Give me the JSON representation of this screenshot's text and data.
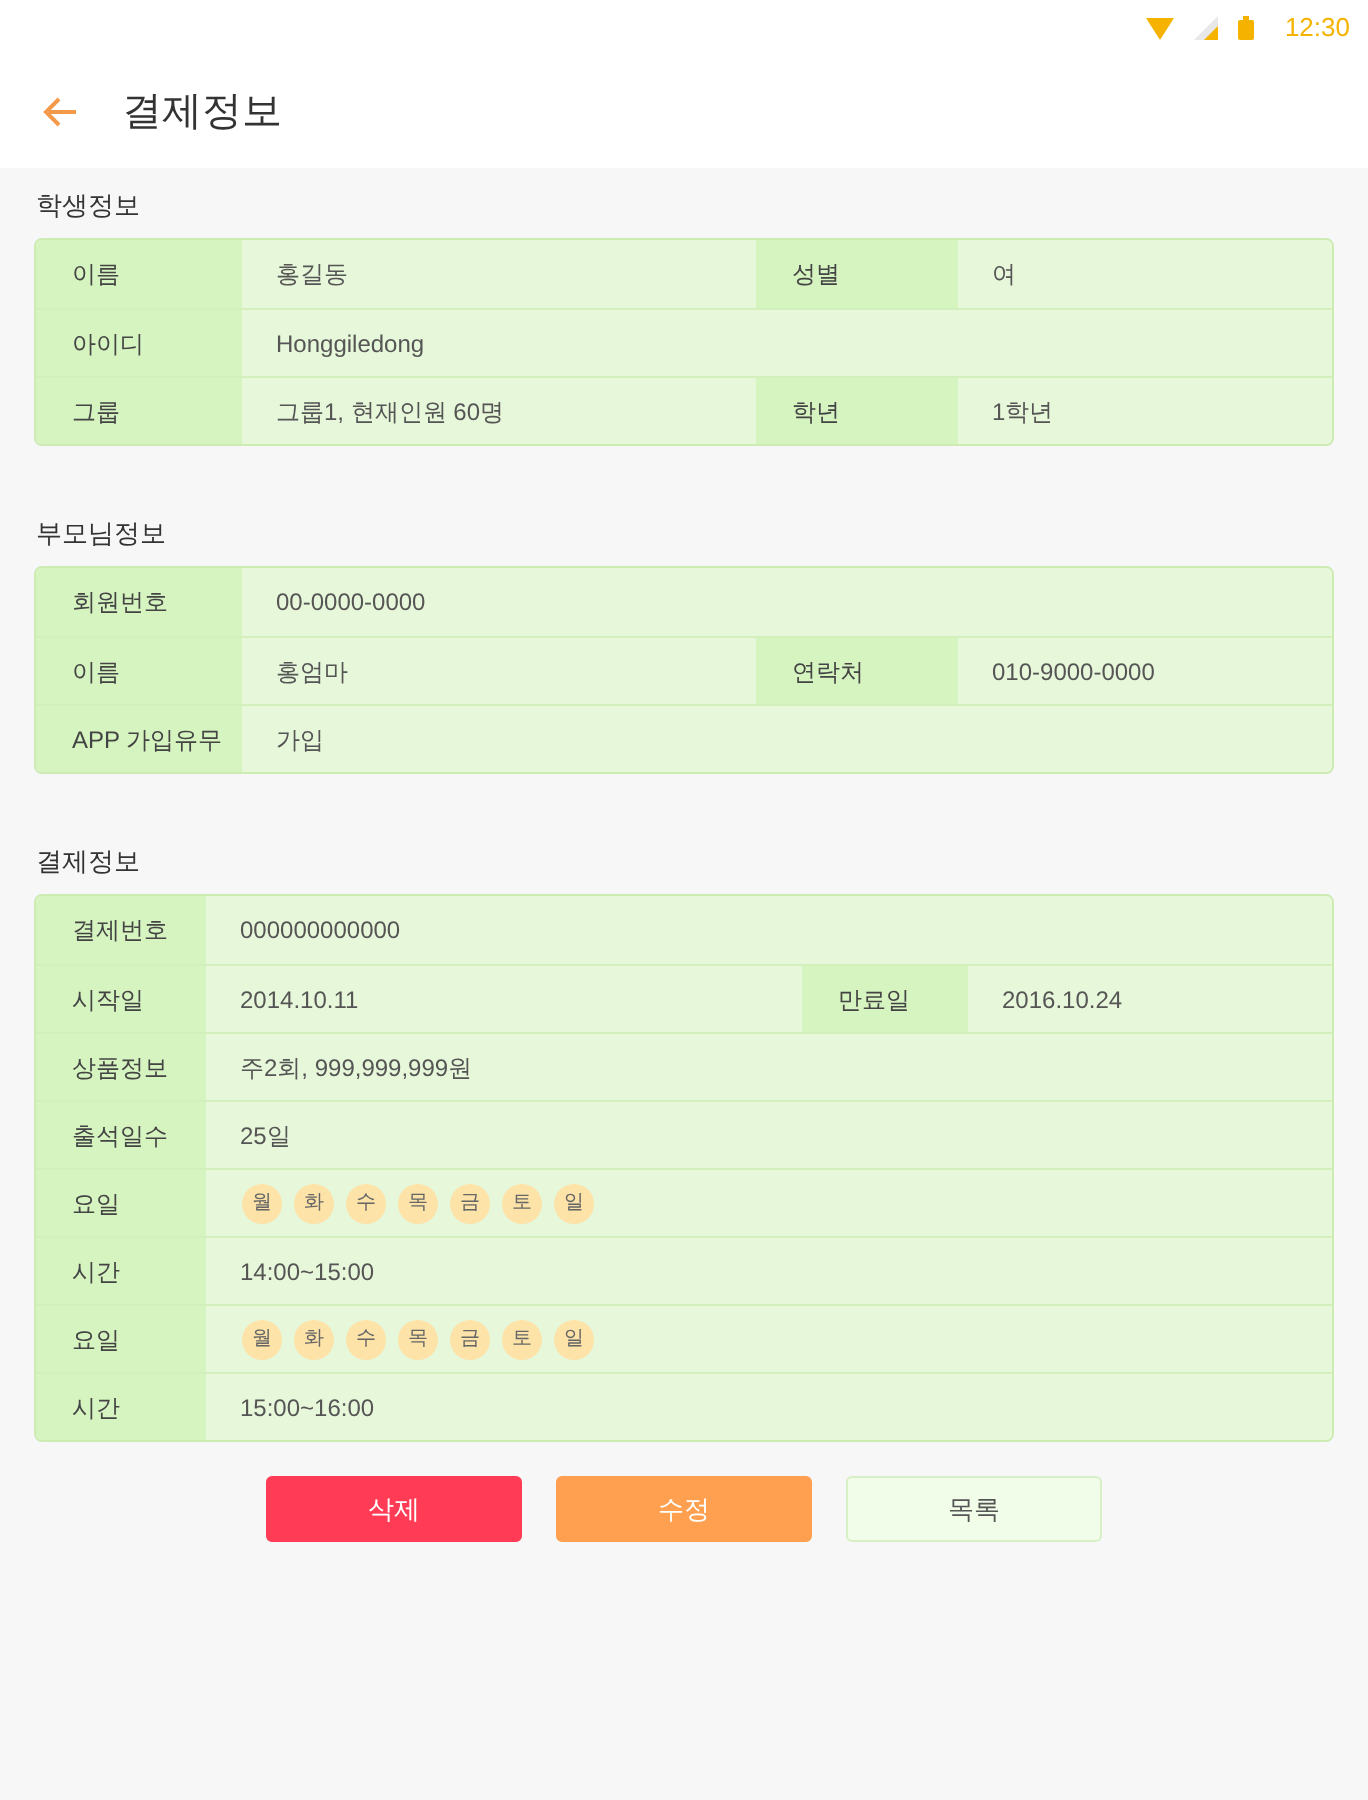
{
  "status_bar": {
    "time": "12:30"
  },
  "app_bar": {
    "title": "결제정보"
  },
  "sections": [
    {
      "title": "학생정보",
      "rows": [
        {
          "kind": "pair",
          "label": "이름",
          "value": "홍길동",
          "label_2": "성별",
          "value_2": "여"
        },
        {
          "kind": "single",
          "label": "아이디",
          "value": "Honggiledong"
        },
        {
          "kind": "pair",
          "label": "그룹",
          "value": "그룹1, 현재인원 60명",
          "label_2": "학년",
          "value_2": "1학년"
        }
      ]
    },
    {
      "title": "부모님정보",
      "rows": [
        {
          "kind": "single",
          "label": "회원번호",
          "value": "00-0000-0000"
        },
        {
          "kind": "pair",
          "label": "이름",
          "value": "홍엄마",
          "label_2": "연락처",
          "value_2": "010-9000-0000"
        },
        {
          "kind": "single",
          "label": "APP 가입유무",
          "value": "가입"
        }
      ]
    },
    {
      "title": "결제정보",
      "rows": [
        {
          "kind": "single",
          "label": "결제번호",
          "value": "000000000000"
        },
        {
          "kind": "pair",
          "label": "시작일",
          "value": "2014.10.11",
          "label_2": "만료일",
          "value_2": "2016.10.24"
        },
        {
          "kind": "single",
          "label": "상품정보",
          "value": "주2회, 999,999,999원"
        },
        {
          "kind": "single",
          "label": "출석일수",
          "value": "25일"
        },
        {
          "kind": "days",
          "label": "요일",
          "days": [
            "월",
            "화",
            "수",
            "목",
            "금",
            "토",
            "일"
          ]
        },
        {
          "kind": "single",
          "label": "시간",
          "value": "14:00~15:00"
        },
        {
          "kind": "days",
          "label": "요일",
          "days": [
            "월",
            "화",
            "수",
            "목",
            "금",
            "토",
            "일"
          ]
        },
        {
          "kind": "single",
          "label": "시간",
          "value": "15:00~16:00"
        }
      ]
    }
  ],
  "buttons": [
    {
      "kind": "danger",
      "label": "삭제"
    },
    {
      "kind": "warning",
      "label": "수정"
    },
    {
      "kind": "default",
      "label": "목록"
    }
  ]
}
